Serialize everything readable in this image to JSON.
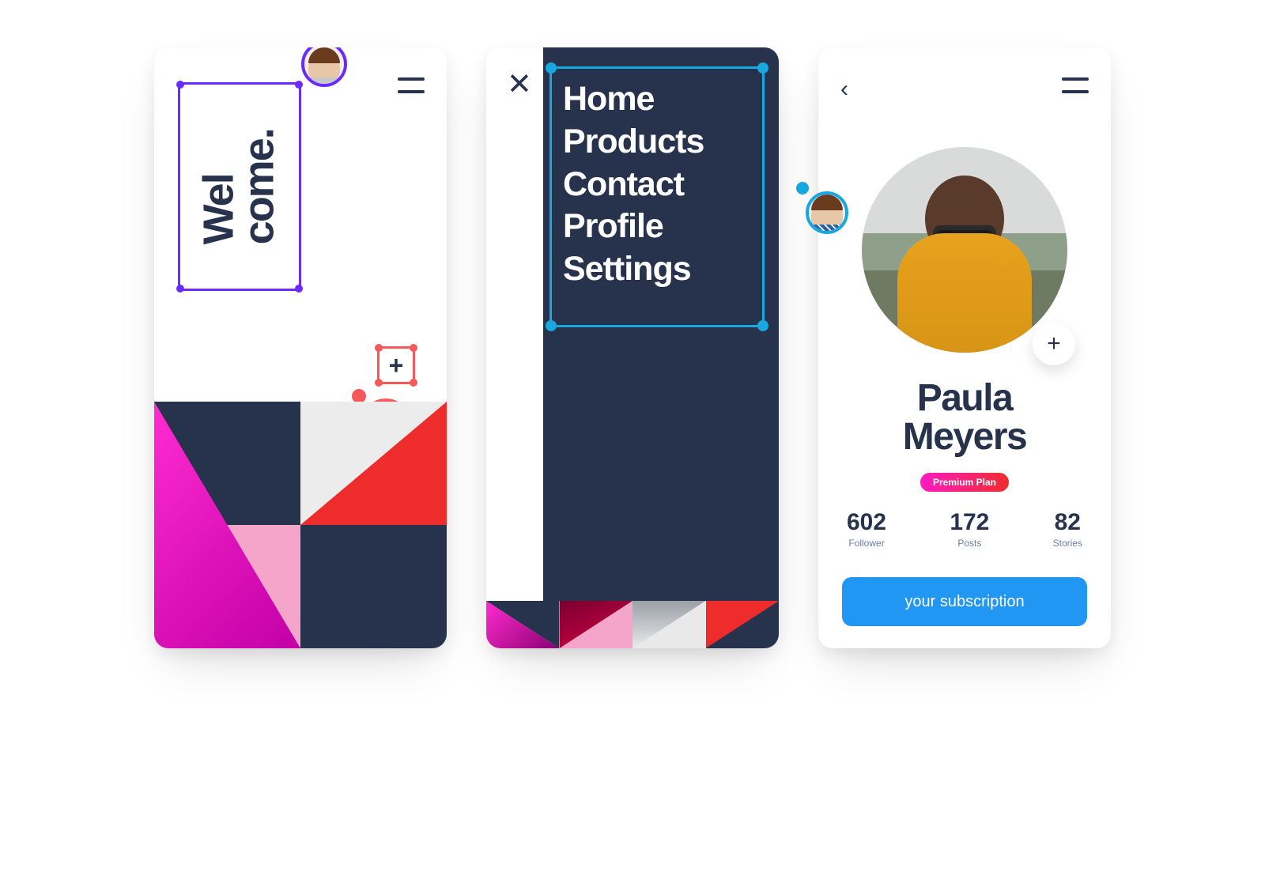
{
  "screen1": {
    "welcome_line1": "Wel",
    "welcome_line2": "come.",
    "add_glyph": "+"
  },
  "screen2": {
    "menu": [
      "Home",
      "Products",
      "Contact",
      "Profile",
      "Settings"
    ]
  },
  "screen3": {
    "name_line1": "Paula",
    "name_line2": "Meyers",
    "plan_label": "Premium Plan",
    "stats": {
      "follower": {
        "value": "602",
        "label": "Follower"
      },
      "posts": {
        "value": "172",
        "label": "Posts"
      },
      "stories": {
        "value": "82",
        "label": "Stories"
      }
    },
    "cta_label": "your subscription",
    "add_glyph": "+"
  }
}
